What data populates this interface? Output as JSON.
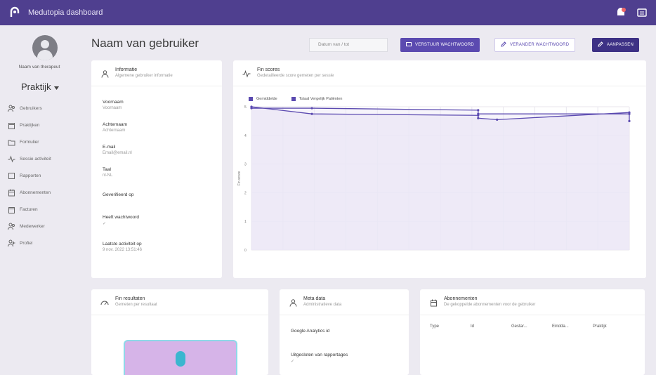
{
  "app": {
    "title": "Medutopia dashboard"
  },
  "sidebar": {
    "user_role": "Naam van therapeut",
    "practice": "Praktijk",
    "items": [
      {
        "icon": "users-icon",
        "label": "Gebruikers"
      },
      {
        "icon": "document-icon",
        "label": "Praktijken"
      },
      {
        "icon": "folder-icon",
        "label": "Formulier"
      },
      {
        "icon": "activity-icon",
        "label": "Sessie activiteit"
      },
      {
        "icon": "report-icon",
        "label": "Rapporten"
      },
      {
        "icon": "calendar-icon",
        "label": "Abonnementen"
      },
      {
        "icon": "file-icon",
        "label": "Facturen"
      },
      {
        "icon": "team-icon",
        "label": "Medewerker"
      },
      {
        "icon": "user-add-icon",
        "label": "Profiel"
      }
    ]
  },
  "page": {
    "title": "Naam van gebruiker",
    "date_placeholder": "Datum van / tot",
    "btn_send": "VERSTUUR WACHTWOORD",
    "btn_change": "VERANDER WACHTWOORD",
    "btn_edit": "AANPASSEN"
  },
  "info_card": {
    "title": "Informatie",
    "subtitle": "Algemene gebruiker informatie",
    "fields": [
      {
        "label": "Voornaam",
        "value": "Voornaam"
      },
      {
        "label": "Achternaam",
        "value": "Achternaam"
      },
      {
        "label": "E-mail",
        "value": "Email@email.nl"
      },
      {
        "label": "Taal",
        "value": "nl-NL"
      },
      {
        "label": "Geverifieerd op",
        "value": ""
      },
      {
        "label": "Heeft wachtwoord",
        "value": "✓"
      },
      {
        "label": "Laatste activiteit op",
        "value": "9 nov. 2022 13:51:46"
      }
    ]
  },
  "fin_card": {
    "title": "Fin scores",
    "subtitle": "Gedetailleerde score gemeten per sessie"
  },
  "chart_data": {
    "type": "line",
    "ylabel": "Fin score",
    "series": [
      {
        "name": "Gemiddelde",
        "points": [
          [
            0,
            5.0
          ],
          [
            0.16,
            4.75
          ],
          [
            0.6,
            4.7
          ],
          [
            0.6,
            4.6
          ],
          [
            0.65,
            4.55
          ],
          [
            1,
            4.8
          ]
        ]
      },
      {
        "name": "Totaal Vergelijk Patiënten",
        "points": [
          [
            0,
            4.95
          ],
          [
            0.16,
            4.95
          ],
          [
            0.6,
            4.88
          ],
          [
            0.6,
            4.75
          ],
          [
            1,
            4.75
          ],
          [
            1,
            4.5
          ]
        ]
      }
    ],
    "ylim": [
      0,
      5
    ],
    "grid": true,
    "legend": "top-left"
  },
  "fin_results": {
    "title": "Fin resultaten",
    "subtitle": "Gemeten per resultaat"
  },
  "meta_card": {
    "title": "Meta data",
    "subtitle": "Administratieve data",
    "field1_label": "Google Analytics id",
    "field2_label": "Uitgesloten van rapportages",
    "field2_value": "✓"
  },
  "subs_card": {
    "title": "Abonnementen",
    "subtitle": "De gekoppelde abonnementen voor de gebruiker",
    "columns": [
      "Type",
      "Id",
      "Gestar...",
      "Eindda...",
      "Praktijk"
    ]
  },
  "colors": {
    "brand": "#4f3f8f",
    "accent": "#5b4ab0",
    "fill": "#ebe7f6"
  }
}
